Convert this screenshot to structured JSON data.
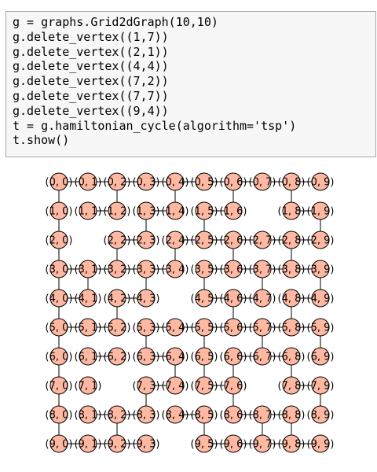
{
  "code_cell": {
    "lines": [
      "g = graphs.Grid2dGraph(10,10)",
      "g.delete_vertex((1,7))",
      "g.delete_vertex((2,1))",
      "g.delete_vertex((4,4))",
      "g.delete_vertex((7,2))",
      "g.delete_vertex((7,7))",
      "g.delete_vertex((9,4))",
      "t = g.hamiltonian_cycle(algorithm='tsp')",
      "t.show()"
    ]
  },
  "graph": {
    "rows": 10,
    "cols": 10,
    "deleted_vertices": [
      "1,7",
      "2,1",
      "4,4",
      "7,2",
      "7,7",
      "9,4"
    ],
    "node_color": "#ffb9a2",
    "node_stroke": "#000000",
    "edge_color": "#000000",
    "vertex_labels": {
      "0,0": "(0, 0)",
      "0,1": "(0, 1)",
      "0,2": "(0, 2)",
      "0,3": "(0, 3)",
      "0,4": "(0, 4)",
      "0,5": "(0, 5)",
      "0,6": "(0, 6)",
      "0,7": "(0, 7)",
      "0,8": "(0, 8)",
      "0,9": "(0, 9)",
      "1,0": "(1, 0)",
      "1,1": "(1, 1)",
      "1,2": "(1, 2)",
      "1,3": "(1, 3)",
      "1,4": "(1, 4)",
      "1,5": "(1, 5)",
      "1,6": "(1, 6)",
      "1,8": "(1, 8)",
      "1,9": "(1, 9)",
      "2,0": "(2, 0)",
      "2,2": "(2, 2)",
      "2,3": "(2, 3)",
      "2,4": "(2, 4)",
      "2,5": "(2, 5)",
      "2,6": "(2, 6)",
      "2,7": "(2, 7)",
      "2,8": "(2, 8)",
      "2,9": "(2, 9)",
      "3,0": "(3, 0)",
      "3,1": "(3, 1)",
      "3,2": "(3, 2)",
      "3,3": "(3, 3)",
      "3,4": "(3, 4)",
      "3,5": "(3, 5)",
      "3,6": "(3, 6)",
      "3,7": "(3, 7)",
      "3,8": "(3, 8)",
      "3,9": "(3, 9)",
      "4,0": "(4, 0)",
      "4,1": "(4, 1)",
      "4,2": "(4, 2)",
      "4,3": "(4, 3)",
      "4,5": "(4, 5)",
      "4,6": "(4, 6)",
      "4,7": "(4, 7)",
      "4,8": "(4, 8)",
      "4,9": "(4, 9)",
      "5,0": "(5, 0)",
      "5,1": "(5, 1)",
      "5,2": "(5, 2)",
      "5,3": "(5, 3)",
      "5,4": "(5, 4)",
      "5,5": "(5, 5)",
      "5,6": "(5, 6)",
      "5,7": "(5, 7)",
      "5,8": "(5, 8)",
      "5,9": "(5, 9)",
      "6,0": "(6, 0)",
      "6,1": "(6, 1)",
      "6,2": "(6, 2)",
      "6,3": "(6, 3)",
      "6,4": "(6, 4)",
      "6,5": "(6, 5)",
      "6,6": "(6, 6)",
      "6,7": "(6, 7)",
      "6,8": "(6, 8)",
      "6,9": "(6, 9)",
      "7,0": "(7, 0)",
      "7,1": "(7, 1)",
      "7,3": "(7, 3)",
      "7,4": "(7, 4)",
      "7,5": "(7, 5)",
      "7,6": "(7, 6)",
      "7,8": "(7, 8)",
      "7,9": "(7, 9)",
      "8,0": "(8, 0)",
      "8,1": "(8, 1)",
      "8,2": "(8, 2)",
      "8,3": "(8, 3)",
      "8,4": "(8, 4)",
      "8,5": "(8, 5)",
      "8,6": "(8, 6)",
      "8,7": "(8, 7)",
      "8,8": "(8, 8)",
      "8,9": "(8, 9)",
      "9,0": "(9, 0)",
      "9,1": "(9, 1)",
      "9,2": "(9, 2)",
      "9,3": "(9, 3)",
      "9,5": "(9, 5)",
      "9,6": "(9, 6)",
      "9,7": "(9, 7)",
      "9,8": "(9, 8)",
      "9,9": "(9, 9)"
    },
    "edges": [
      [
        "0,0",
        "0,1"
      ],
      [
        "0,1",
        "0,2"
      ],
      [
        "0,2",
        "0,3"
      ],
      [
        "0,3",
        "0,4"
      ],
      [
        "0,4",
        "0,5"
      ],
      [
        "0,5",
        "0,6"
      ],
      [
        "0,6",
        "0,7"
      ],
      [
        "0,7",
        "0,8"
      ],
      [
        "0,8",
        "0,9"
      ],
      [
        "1,1",
        "1,2"
      ],
      [
        "1,3",
        "1,4"
      ],
      [
        "1,5",
        "1,6"
      ],
      [
        "1,8",
        "1,9"
      ],
      [
        "2,2",
        "2,3"
      ],
      [
        "2,4",
        "2,5"
      ],
      [
        "2,5",
        "2,6"
      ],
      [
        "2,6",
        "2,7"
      ],
      [
        "2,7",
        "2,8"
      ],
      [
        "2,8",
        "2,9"
      ],
      [
        "3,0",
        "3,1"
      ],
      [
        "3,1",
        "3,2"
      ],
      [
        "3,2",
        "3,3"
      ],
      [
        "3,3",
        "3,4"
      ],
      [
        "3,5",
        "3,6"
      ],
      [
        "3,6",
        "3,7"
      ],
      [
        "3,7",
        "3,8"
      ],
      [
        "3,8",
        "3,9"
      ],
      [
        "4,0",
        "4,1"
      ],
      [
        "4,2",
        "4,3"
      ],
      [
        "4,5",
        "4,6"
      ],
      [
        "4,6",
        "4,7"
      ],
      [
        "4,8",
        "4,9"
      ],
      [
        "5,0",
        "5,1"
      ],
      [
        "5,1",
        "5,2"
      ],
      [
        "5,3",
        "5,4"
      ],
      [
        "5,4",
        "5,5"
      ],
      [
        "5,5",
        "5,6"
      ],
      [
        "5,6",
        "5,7"
      ],
      [
        "5,7",
        "5,8"
      ],
      [
        "5,8",
        "5,9"
      ],
      [
        "6,1",
        "6,2"
      ],
      [
        "6,3",
        "6,4"
      ],
      [
        "6,6",
        "6,7"
      ],
      [
        "6,7",
        "6,8"
      ],
      [
        "7,3",
        "7,4"
      ],
      [
        "7,5",
        "7,6"
      ],
      [
        "7,8",
        "7,9"
      ],
      [
        "8,1",
        "8,2"
      ],
      [
        "8,2",
        "8,3"
      ],
      [
        "8,4",
        "8,5"
      ],
      [
        "8,6",
        "8,7"
      ],
      [
        "8,7",
        "8,8"
      ],
      [
        "9,0",
        "9,1"
      ],
      [
        "9,1",
        "9,2"
      ],
      [
        "9,2",
        "9,3"
      ],
      [
        "9,5",
        "9,6"
      ],
      [
        "9,6",
        "9,7"
      ],
      [
        "9,7",
        "9,8"
      ],
      [
        "9,8",
        "9,9"
      ],
      [
        "0,0",
        "1,0"
      ],
      [
        "1,0",
        "2,0"
      ],
      [
        "2,0",
        "3,0"
      ],
      [
        "3,0",
        "4,0"
      ],
      [
        "4,0",
        "5,0"
      ],
      [
        "5,0",
        "6,0"
      ],
      [
        "6,0",
        "7,0"
      ],
      [
        "7,0",
        "8,0"
      ],
      [
        "8,0",
        "9,0"
      ],
      [
        "1,1",
        "2,1"
      ],
      [
        "3,1",
        "4,1"
      ],
      [
        "0,2",
        "1,2"
      ],
      [
        "2,2",
        "3,2"
      ],
      [
        "4,2",
        "5,2"
      ],
      [
        "6,2",
        "7,2"
      ],
      [
        "8,2",
        "9,2"
      ],
      [
        "1,3",
        "2,3"
      ],
      [
        "3,3",
        "4,3"
      ],
      [
        "5,3",
        "6,3"
      ],
      [
        "7,3",
        "8,3"
      ],
      [
        "0,4",
        "1,4"
      ],
      [
        "2,4",
        "3,4"
      ],
      [
        "4,4",
        "5,4"
      ],
      [
        "6,4",
        "7,4"
      ],
      [
        "8,4",
        "9,4"
      ],
      [
        "1,5",
        "2,5"
      ],
      [
        "3,5",
        "4,5"
      ],
      [
        "5,5",
        "6,5"
      ],
      [
        "6,5",
        "7,5"
      ],
      [
        "8,5",
        "9,5"
      ],
      [
        "0,6",
        "1,6"
      ],
      [
        "2,6",
        "3,6"
      ],
      [
        "4,6",
        "5,6"
      ],
      [
        "6,6",
        "7,6"
      ],
      [
        "7,6",
        "8,6"
      ],
      [
        "1,7",
        "2,7"
      ],
      [
        "3,7",
        "4,7"
      ],
      [
        "5,7",
        "6,7"
      ],
      [
        "8,7",
        "9,7"
      ],
      [
        "0,8",
        "1,8"
      ],
      [
        "2,8",
        "3,8"
      ],
      [
        "4,8",
        "5,8"
      ],
      [
        "6,8",
        "7,8"
      ],
      [
        "8,8",
        "9,8"
      ],
      [
        "1,9",
        "2,9"
      ],
      [
        "3,9",
        "4,9"
      ],
      [
        "5,9",
        "6,9"
      ],
      [
        "7,9",
        "8,9"
      ]
    ]
  }
}
